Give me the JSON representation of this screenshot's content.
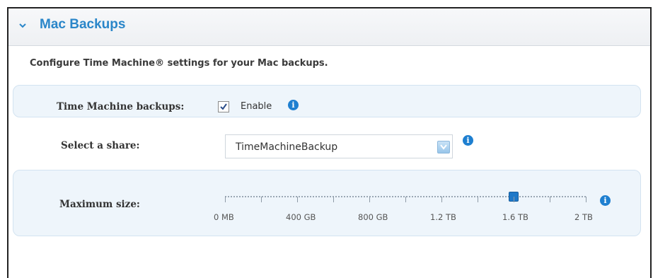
{
  "section": {
    "title": "Mac Backups",
    "description": "Configure Time Machine® settings for your Mac backups."
  },
  "time_machine": {
    "label": "Time Machine backups:",
    "enable_label": "Enable",
    "enabled": true,
    "info_icon": "info-icon"
  },
  "share": {
    "label": "Select a share:",
    "selected": "TimeMachineBackup",
    "info_icon": "info-icon"
  },
  "max_size": {
    "label": "Maximum size:",
    "ticks": [
      "0 MB",
      "400 GB",
      "800 GB",
      "1.2 TB",
      "1.6 TB",
      "2 TB"
    ],
    "value_fraction": 0.8,
    "info_icon": "info-icon"
  },
  "colors": {
    "accent": "#2a86c9",
    "panel": "#eef5fb",
    "info": "#1e7fd0"
  }
}
